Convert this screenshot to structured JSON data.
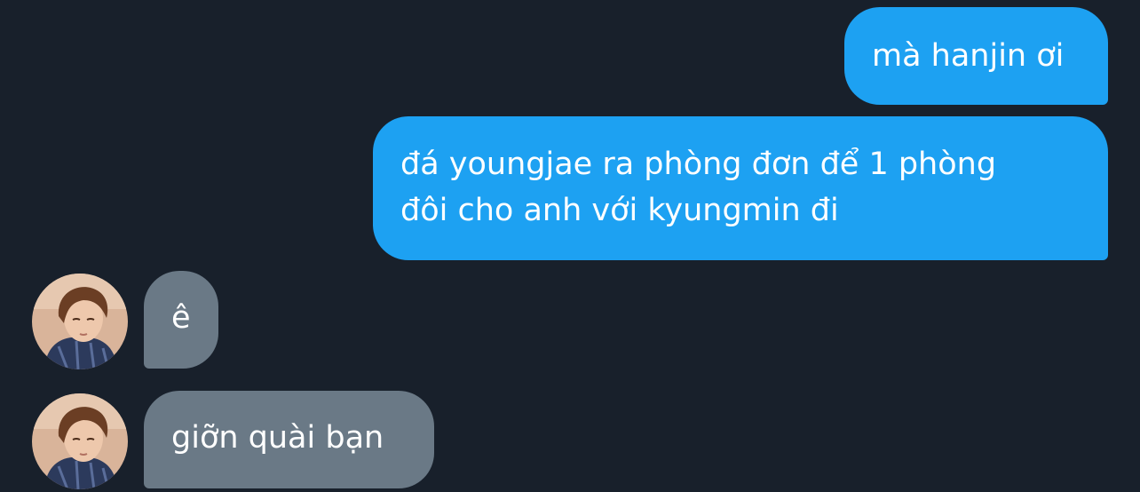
{
  "messages": {
    "sent": [
      {
        "lines": [
          "mà hanjin ơi"
        ]
      },
      {
        "lines": [
          "đá youngjae ra phòng đơn để 1 phòng",
          "đôi cho anh với kyungmin đi"
        ]
      }
    ],
    "received": [
      {
        "lines": [
          "ê"
        ],
        "avatar": "user-avatar-photo"
      },
      {
        "lines": [
          "giỡn quài bạn"
        ],
        "avatar": "user-avatar-photo"
      }
    ]
  },
  "colors": {
    "background": "#18202b",
    "sent_bubble": "#1da1f2",
    "received_bubble": "#6a7986",
    "text": "#ffffff"
  }
}
